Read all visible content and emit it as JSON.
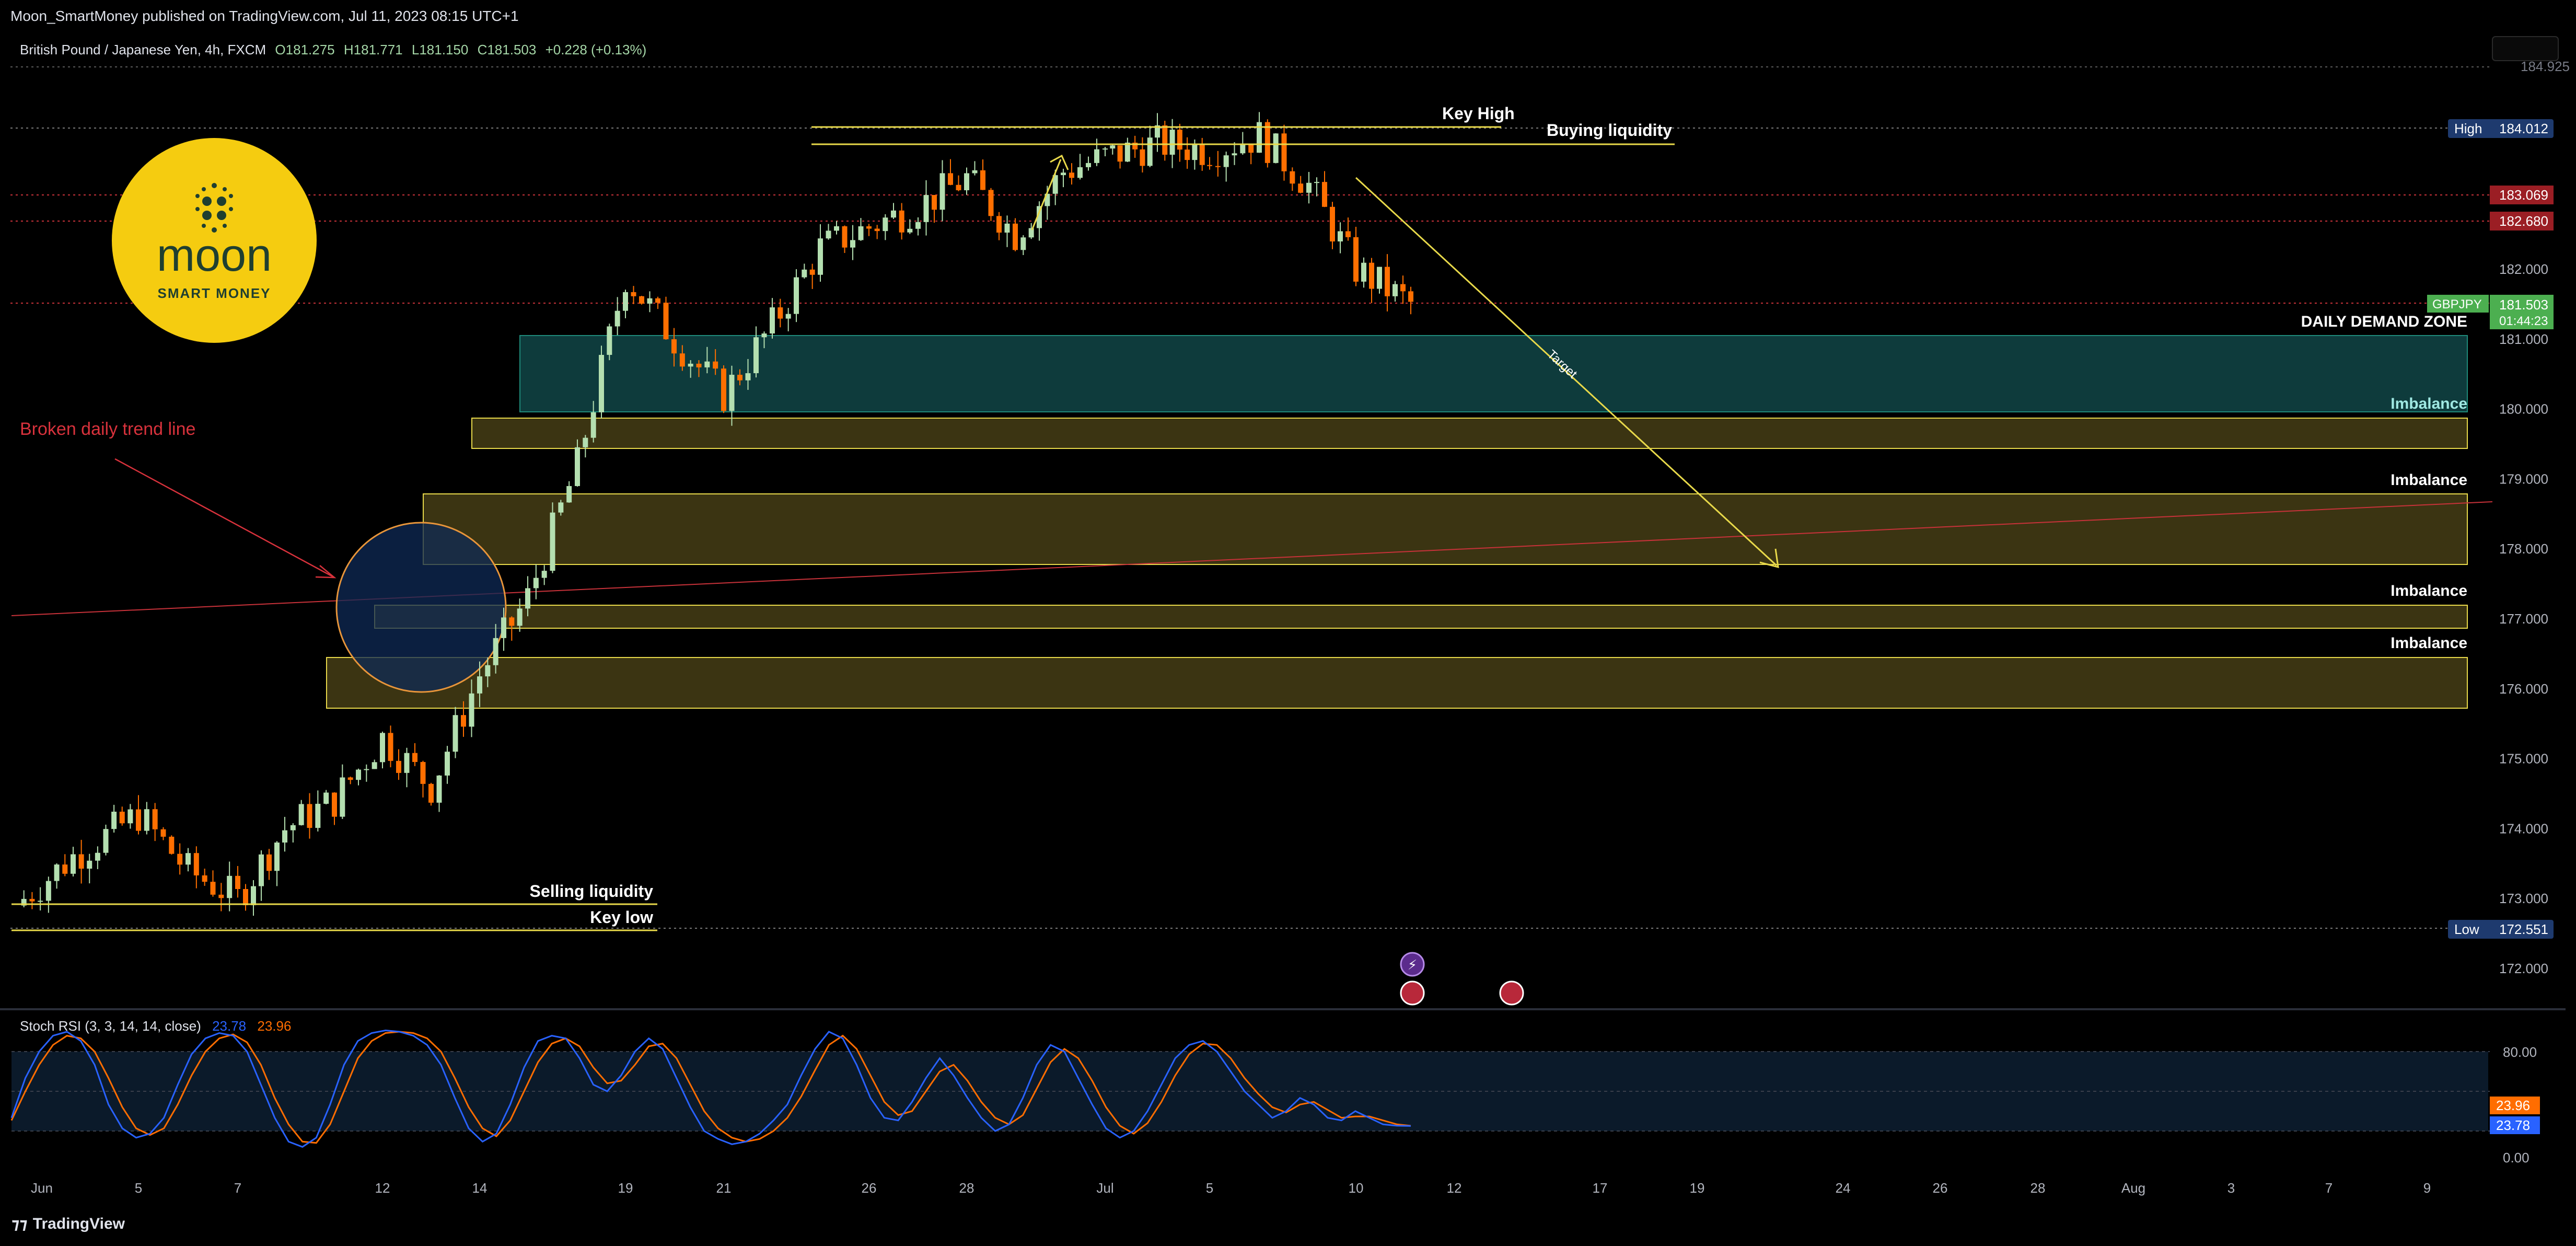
{
  "header": {
    "published": "Moon_SmartMoney published on TradingView.com, Jul 11, 2023 08:15 UTC+1"
  },
  "symbol_line": {
    "name": "British Pound / Japanese Yen, 4h, FXCM",
    "open": "O181.275",
    "high": "H181.771",
    "low": "L181.150",
    "close": "C181.503",
    "change": "+0.228 (+0.13%)"
  },
  "logo": {
    "word": "moon",
    "tagline": "SMART MONEY"
  },
  "annotations": {
    "key_high": "Key High",
    "buying_liquidity": "Buying liquidity",
    "broken_trend": "Broken daily trend line",
    "demand_zone": "DAILY DEMAND ZONE",
    "imbalance": "Imbalance",
    "selling_liquidity": "Selling liquidity",
    "key_low": "Key low",
    "target": "Target"
  },
  "price_axis": {
    "ticks": [
      "182.000",
      "181.000",
      "180.000",
      "179.000",
      "178.000",
      "177.000",
      "176.000",
      "175.000",
      "174.000",
      "173.000",
      "172.000"
    ],
    "top_cut": "184.925",
    "high_label": "High",
    "high_value": "184.012",
    "red1": "183.069",
    "red2": "182.680",
    "symbol_tag": "GBPJPY",
    "last_price": "181.503",
    "countdown": "01:44:23",
    "low_label": "Low",
    "low_value": "172.551"
  },
  "rsi": {
    "title": "Stoch RSI (3, 3, 14, 14, close)",
    "k_value": "23.78",
    "d_value": "23.96",
    "ticks": [
      "80.00",
      "0.00"
    ],
    "k_color": "#2962ff",
    "d_color": "#ff6d00"
  },
  "time_axis": [
    "Jun",
    "5",
    "7",
    "12",
    "14",
    "19",
    "21",
    "26",
    "28",
    "Jul",
    "5",
    "10",
    "12",
    "17",
    "19",
    "24",
    "26",
    "28",
    "Aug",
    "3",
    "7",
    "9"
  ],
  "footer": {
    "brand": "TradingView"
  },
  "colors": {
    "up": "#a5d6a7",
    "down": "#f7525f",
    "bull_candle": "#b4dfb0",
    "bear_candle": "#ff6f00",
    "zone_teal": "#0e3b3c",
    "zone_yellow": "#3b3412",
    "accent_yellow": "#e8d94a"
  },
  "chart_data": {
    "type": "candlestick",
    "title": "British Pound / Japanese Yen, 4h, FXCM",
    "ylim": [
      171.4,
      185.0
    ],
    "close_path": [
      {
        "x": "Jun 1",
        "y": 172.9
      },
      {
        "x": "Jun 2",
        "y": 173.6
      },
      {
        "x": "Jun 5",
        "y": 174.2
      },
      {
        "x": "Jun 6",
        "y": 173.4
      },
      {
        "x": "Jun 7",
        "y": 173.0
      },
      {
        "x": "Jun 8",
        "y": 174.0
      },
      {
        "x": "Jun 9",
        "y": 174.4
      },
      {
        "x": "Jun 12",
        "y": 175.3
      },
      {
        "x": "Jun 13",
        "y": 174.6
      },
      {
        "x": "Jun 14",
        "y": 176.2
      },
      {
        "x": "Jun 15",
        "y": 177.3
      },
      {
        "x": "Jun 16",
        "y": 179.2
      },
      {
        "x": "Jun 19",
        "y": 181.9
      },
      {
        "x": "Jun 20",
        "y": 181.0
      },
      {
        "x": "Jun 21",
        "y": 180.2
      },
      {
        "x": "Jun 22",
        "y": 181.2
      },
      {
        "x": "Jun 23",
        "y": 182.3
      },
      {
        "x": "Jun 26",
        "y": 182.6
      },
      {
        "x": "Jun 27",
        "y": 182.9
      },
      {
        "x": "Jun 28",
        "y": 183.3
      },
      {
        "x": "Jun 29",
        "y": 182.5
      },
      {
        "x": "Jun 30",
        "y": 183.4
      },
      {
        "x": "Jul 3",
        "y": 183.6
      },
      {
        "x": "Jul 4",
        "y": 183.8
      },
      {
        "x": "Jul 5",
        "y": 183.7
      },
      {
        "x": "Jul 6",
        "y": 183.9
      },
      {
        "x": "Jul 7",
        "y": 183.2
      },
      {
        "x": "Jul 10",
        "y": 182.0
      },
      {
        "x": "Jul 11",
        "y": 181.5
      }
    ],
    "levels": {
      "high": 184.012,
      "red_1": 183.069,
      "red_2": 182.68,
      "last": 181.503,
      "low": 172.551,
      "top": 184.925
    },
    "zones": [
      {
        "label": "DAILY DEMAND ZONE",
        "from": 181.0,
        "to": 179.92
      },
      {
        "label": "Imbalance",
        "from": 179.85,
        "to": 179.42
      },
      {
        "label": "Imbalance",
        "from": 178.79,
        "to": 177.77
      },
      {
        "label": "Imbalance",
        "from": 177.21,
        "to": 176.87
      },
      {
        "label": "Imbalance",
        "from": 176.45,
        "to": 175.73
      }
    ],
    "target_line": {
      "from": {
        "x": "Jul 10",
        "y": 182.8
      },
      "to": {
        "x": "Jul 18",
        "y": 177.75
      }
    },
    "stoch_rsi": {
      "ylim": [
        0,
        100
      ],
      "k_last": 23.78,
      "d_last": 23.96,
      "k": [
        30,
        60,
        80,
        92,
        95,
        88,
        70,
        40,
        22,
        15,
        18,
        30,
        55,
        78,
        90,
        94,
        92,
        80,
        55,
        30,
        12,
        8,
        15,
        40,
        70,
        88,
        94,
        96,
        95,
        92,
        85,
        70,
        45,
        22,
        12,
        18,
        40,
        68,
        88,
        92,
        90,
        75,
        55,
        50,
        62,
        80,
        90,
        82,
        60,
        38,
        20,
        14,
        10,
        12,
        18,
        28,
        40,
        62,
        82,
        95,
        90,
        70,
        45,
        30,
        28,
        42,
        60,
        75,
        62,
        45,
        30,
        20,
        25,
        45,
        70,
        85,
        80,
        60,
        40,
        22,
        15,
        20,
        35,
        55,
        75,
        85,
        88,
        80,
        65,
        50,
        40,
        30,
        35,
        45,
        40,
        30,
        28,
        35,
        30,
        25,
        24,
        23.78
      ],
      "d": [
        28,
        50,
        70,
        85,
        92,
        90,
        80,
        60,
        38,
        22,
        17,
        22,
        40,
        62,
        80,
        90,
        93,
        87,
        70,
        45,
        25,
        12,
        11,
        25,
        50,
        75,
        88,
        94,
        95,
        94,
        90,
        80,
        60,
        38,
        22,
        16,
        28,
        50,
        72,
        86,
        90,
        84,
        68,
        56,
        58,
        70,
        84,
        86,
        75,
        55,
        35,
        22,
        15,
        12,
        14,
        20,
        30,
        46,
        66,
        85,
        92,
        82,
        62,
        42,
        32,
        35,
        50,
        65,
        70,
        58,
        42,
        30,
        25,
        32,
        52,
        72,
        82,
        75,
        58,
        38,
        24,
        18,
        26,
        42,
        62,
        78,
        86,
        85,
        75,
        60,
        48,
        38,
        34,
        40,
        42,
        36,
        30,
        31,
        31,
        28,
        25,
        23.96
      ]
    }
  }
}
